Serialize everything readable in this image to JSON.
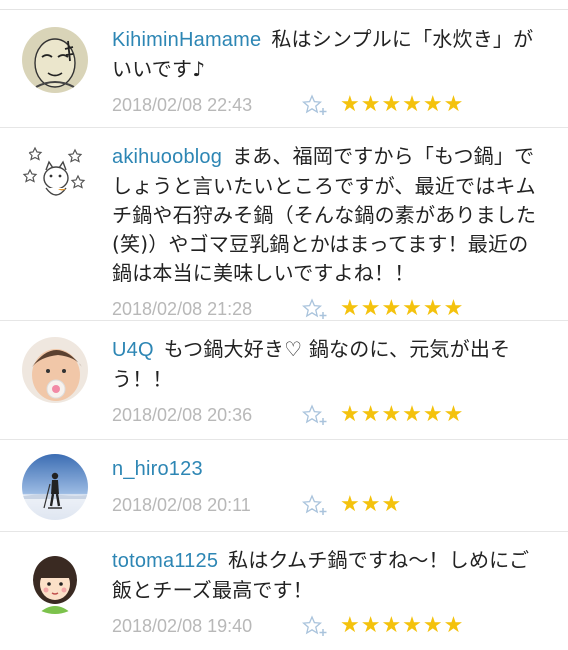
{
  "comments": [
    {
      "user": "KihiminHamame",
      "text": "私はシンプルに「水炊き」がいいです♪",
      "time": "2018/02/08 22:43",
      "stars": "★★★★★★"
    },
    {
      "user": "akihuooblog",
      "text": "まあ、福岡ですから「もつ鍋」でしょうと言いたいところですが、最近ではキムチ鍋や石狩みそ鍋（そんな鍋の素がありました(笑)）やゴマ豆乳鍋とかはまってます！最近の鍋は本当に美味しいですよね！！",
      "time": "2018/02/08 21:28",
      "stars": "★★★★★★"
    },
    {
      "user": "U4Q",
      "text": "もつ鍋大好き♡ 鍋なのに、元気が出そう！！",
      "time": "2018/02/08 20:36",
      "stars": "★★★★★★"
    },
    {
      "user": "n_hiro123",
      "text": "",
      "time": "2018/02/08 20:11",
      "stars": "★★★"
    },
    {
      "user": "totoma1125",
      "text": "私はクムチ鍋ですね～！しめにご飯とチーズ最高です！",
      "time": "2018/02/08 19:40",
      "stars": "★★★★★★"
    }
  ],
  "colors": {
    "username": "#2d86b4",
    "star": "#f4c20d",
    "timestamp": "#b8b8b8",
    "add_star_icon": "#a9c3dc"
  },
  "icons": {
    "add_star": "star-plus-icon"
  }
}
